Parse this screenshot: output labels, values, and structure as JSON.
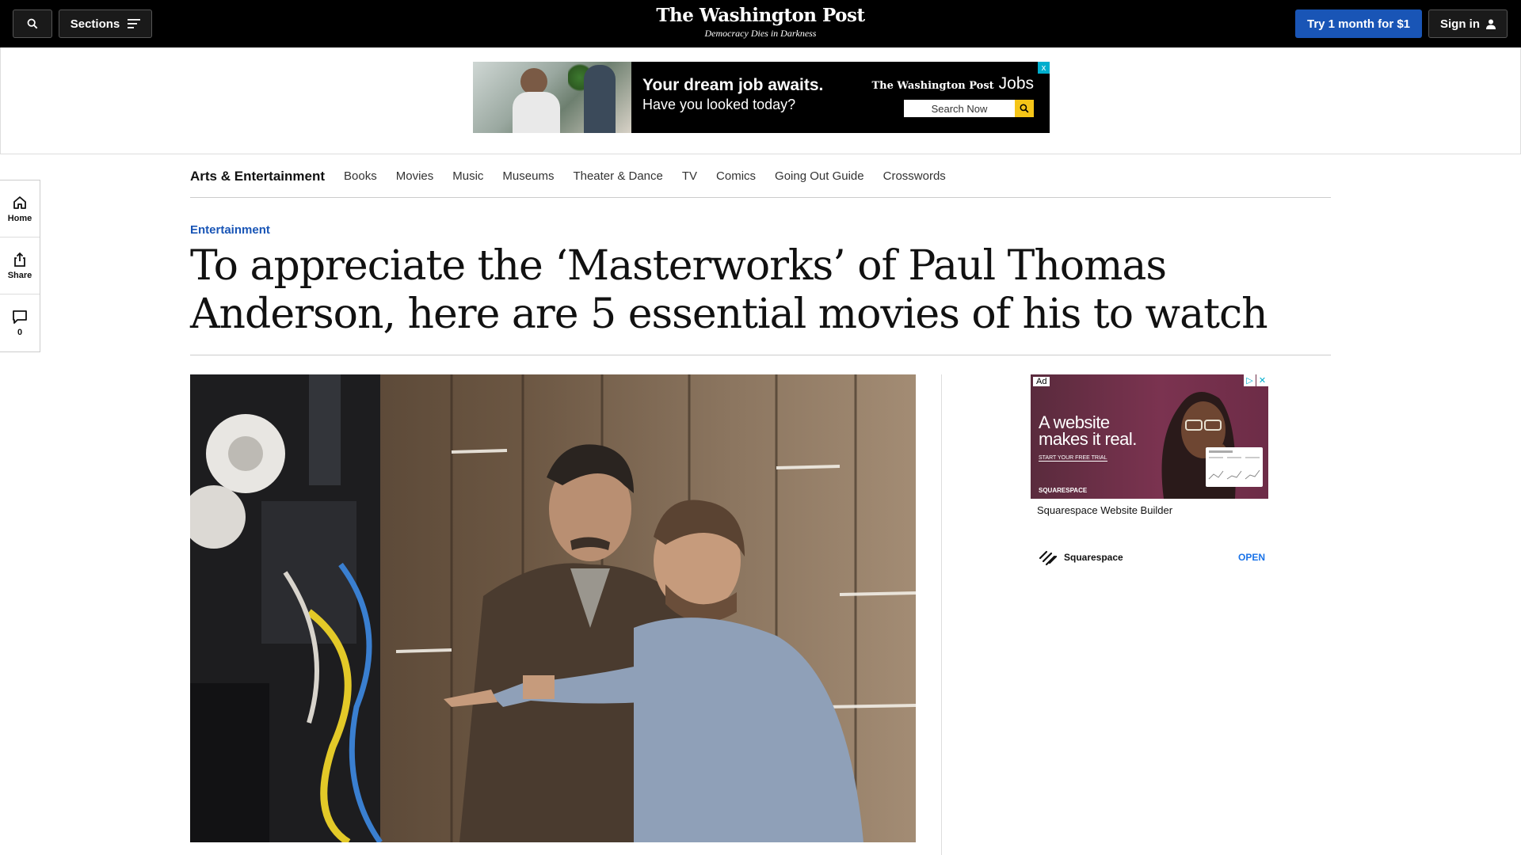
{
  "topbar": {
    "sections_label": "Sections",
    "logo": "The Washington Post",
    "tagline": "Democracy Dies in Darkness",
    "trial_label": "Try 1 month for $1",
    "signin_label": "Sign in"
  },
  "banner_ad": {
    "headline": "Your dream job awaits.",
    "subline": "Have you looked today?",
    "brand": "The Washington Post",
    "brand_product": "Jobs",
    "search_label": "Search Now",
    "close_glyph": "x"
  },
  "subnav": {
    "brand": "Arts & Entertainment",
    "links": [
      "Books",
      "Movies",
      "Music",
      "Museums",
      "Theater & Dance",
      "TV",
      "Comics",
      "Going Out Guide",
      "Crosswords"
    ]
  },
  "rail": {
    "home": "Home",
    "share": "Share",
    "comments_count": "0"
  },
  "article": {
    "kicker": "Entertainment",
    "headline": "To appreciate the ‘Masterworks’ of Paul Thomas Anderson, here are 5 essential movies of his to watch"
  },
  "side_ad": {
    "badge": "Ad",
    "headline": "A website makes it real.",
    "cta": "START YOUR FREE TRIAL",
    "logo_small": "SQUARESPACE",
    "caption": "Squarespace Website Builder",
    "advertiser": "Squarespace",
    "open_label": "OPEN"
  },
  "colors": {
    "accent_blue": "#1955b6",
    "topbar": "#000000",
    "open_link": "#1a73e8"
  }
}
